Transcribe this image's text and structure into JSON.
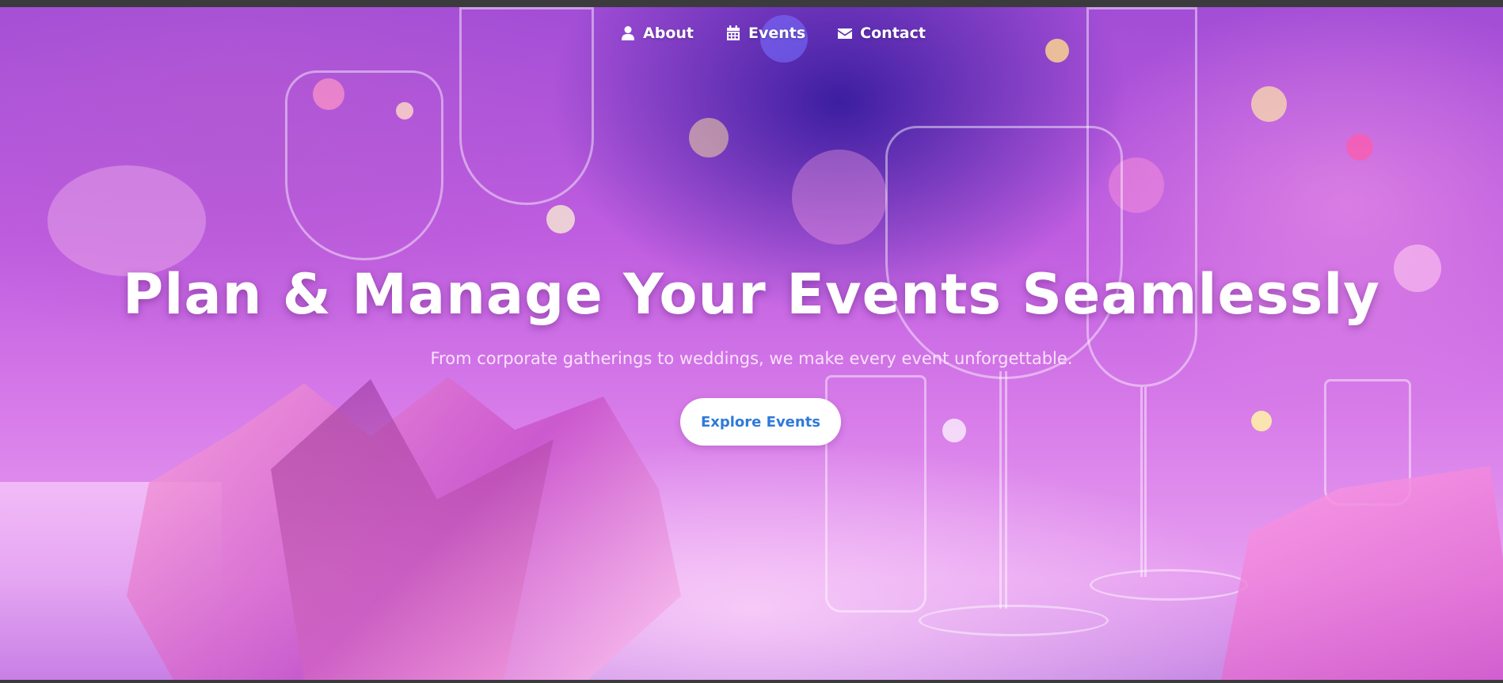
{
  "nav": {
    "items": [
      {
        "label": "About",
        "icon": "user-icon"
      },
      {
        "label": "Events",
        "icon": "calendar-icon"
      },
      {
        "label": "Contact",
        "icon": "envelope-icon"
      }
    ]
  },
  "hero": {
    "title": "Plan & Manage Your Events Seamlessly",
    "subtitle": "From corporate gatherings to weddings, we make every event unforgettable.",
    "cta_label": "Explore Events"
  },
  "colors": {
    "accent": "#2f7ad8",
    "hero_tint": "#c05ee0",
    "text": "#ffffff"
  }
}
